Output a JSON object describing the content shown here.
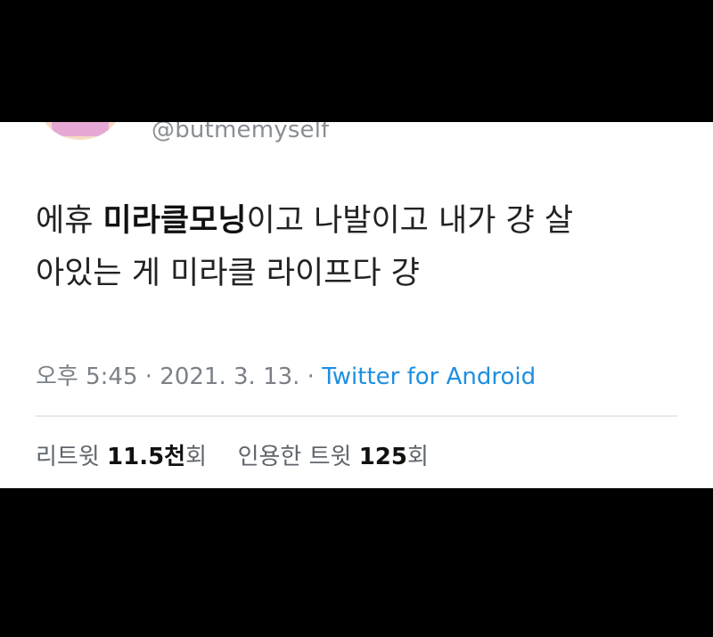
{
  "tweet": {
    "handle": "@butmemyself",
    "text": {
      "part1": "에휴 ",
      "bold": "미라클모닝",
      "part2": "이고 나발이고 내가 걍 살",
      "line2": "아있는 게 미라클 라이프다 걍"
    },
    "time": "오후 5:45",
    "date": "2021. 3. 13.",
    "separator": " · ",
    "source": "Twitter for Android"
  },
  "stats": {
    "retweet_label": "리트윗",
    "retweet_count": "11.5천",
    "retweet_unit": "회",
    "quote_label": "인용한 트윗",
    "quote_count": "125",
    "quote_unit": "회"
  },
  "colors": {
    "link": "#1d8fe0",
    "background": "#000000",
    "card": "#ffffff"
  }
}
